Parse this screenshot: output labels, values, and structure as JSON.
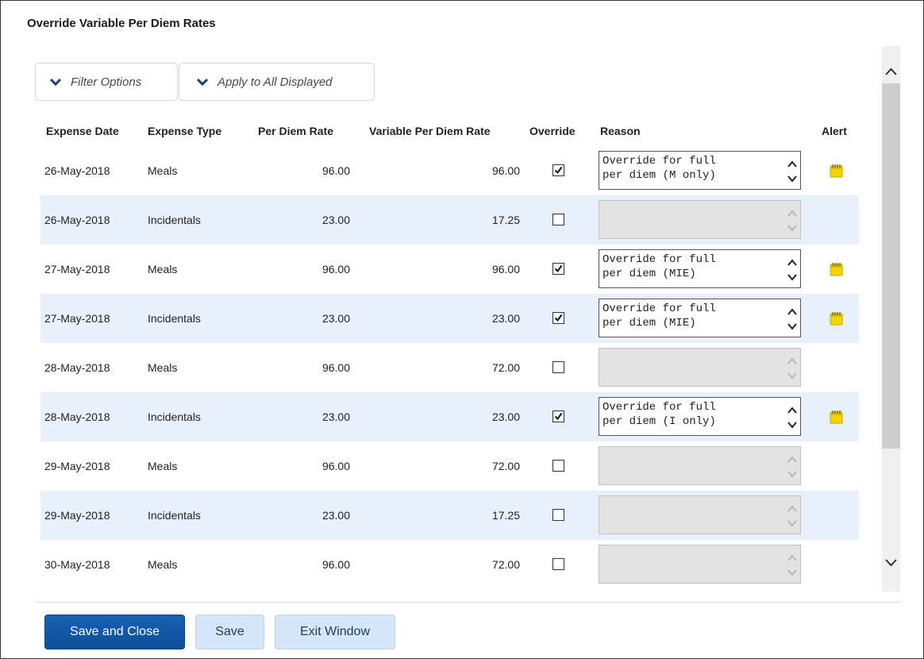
{
  "title": "Override Variable Per Diem Rates",
  "accordions": {
    "filter_label": "Filter Options",
    "apply_label": "Apply to All Displayed"
  },
  "columns": {
    "expense_date": "Expense Date",
    "expense_type": "Expense Type",
    "per_diem_rate": "Per Diem Rate",
    "variable_rate": "Variable Per Diem Rate",
    "override": "Override",
    "reason": "Reason",
    "alert": "Alert"
  },
  "rows": [
    {
      "date": "26-May-2018",
      "type": "Meals",
      "rate": "96.00",
      "variable": "96.00",
      "override": true,
      "reason": "Override for full\nper diem (M only)",
      "alert": true
    },
    {
      "date": "26-May-2018",
      "type": "Incidentals",
      "rate": "23.00",
      "variable": "17.25",
      "override": false,
      "reason": "",
      "alert": false
    },
    {
      "date": "27-May-2018",
      "type": "Meals",
      "rate": "96.00",
      "variable": "96.00",
      "override": true,
      "reason": "Override for full\nper diem (MIE)",
      "alert": true
    },
    {
      "date": "27-May-2018",
      "type": "Incidentals",
      "rate": "23.00",
      "variable": "23.00",
      "override": true,
      "reason": "Override for full\nper diem (MIE)",
      "alert": true
    },
    {
      "date": "28-May-2018",
      "type": "Meals",
      "rate": "96.00",
      "variable": "72.00",
      "override": false,
      "reason": "",
      "alert": false
    },
    {
      "date": "28-May-2018",
      "type": "Incidentals",
      "rate": "23.00",
      "variable": "23.00",
      "override": true,
      "reason": "Override for full\nper diem (I only)",
      "alert": true
    },
    {
      "date": "29-May-2018",
      "type": "Meals",
      "rate": "96.00",
      "variable": "72.00",
      "override": false,
      "reason": "",
      "alert": false
    },
    {
      "date": "29-May-2018",
      "type": "Incidentals",
      "rate": "23.00",
      "variable": "17.25",
      "override": false,
      "reason": "",
      "alert": false
    },
    {
      "date": "30-May-2018",
      "type": "Meals",
      "rate": "96.00",
      "variable": "72.00",
      "override": false,
      "reason": "",
      "alert": false
    }
  ],
  "buttons": {
    "save_close": "Save and Close",
    "save": "Save",
    "exit": "Exit Window"
  },
  "colors": {
    "primary": "#0d4e98",
    "secondary": "#d4e6f8",
    "alt_row": "#e8f1fb",
    "alert_icon": "#f2d600"
  },
  "icons": {
    "accordion": "chevron-down-icon",
    "alert": "sticky-note-icon",
    "scroll_up": "chevron-up-icon",
    "scroll_down": "chevron-down-icon"
  }
}
